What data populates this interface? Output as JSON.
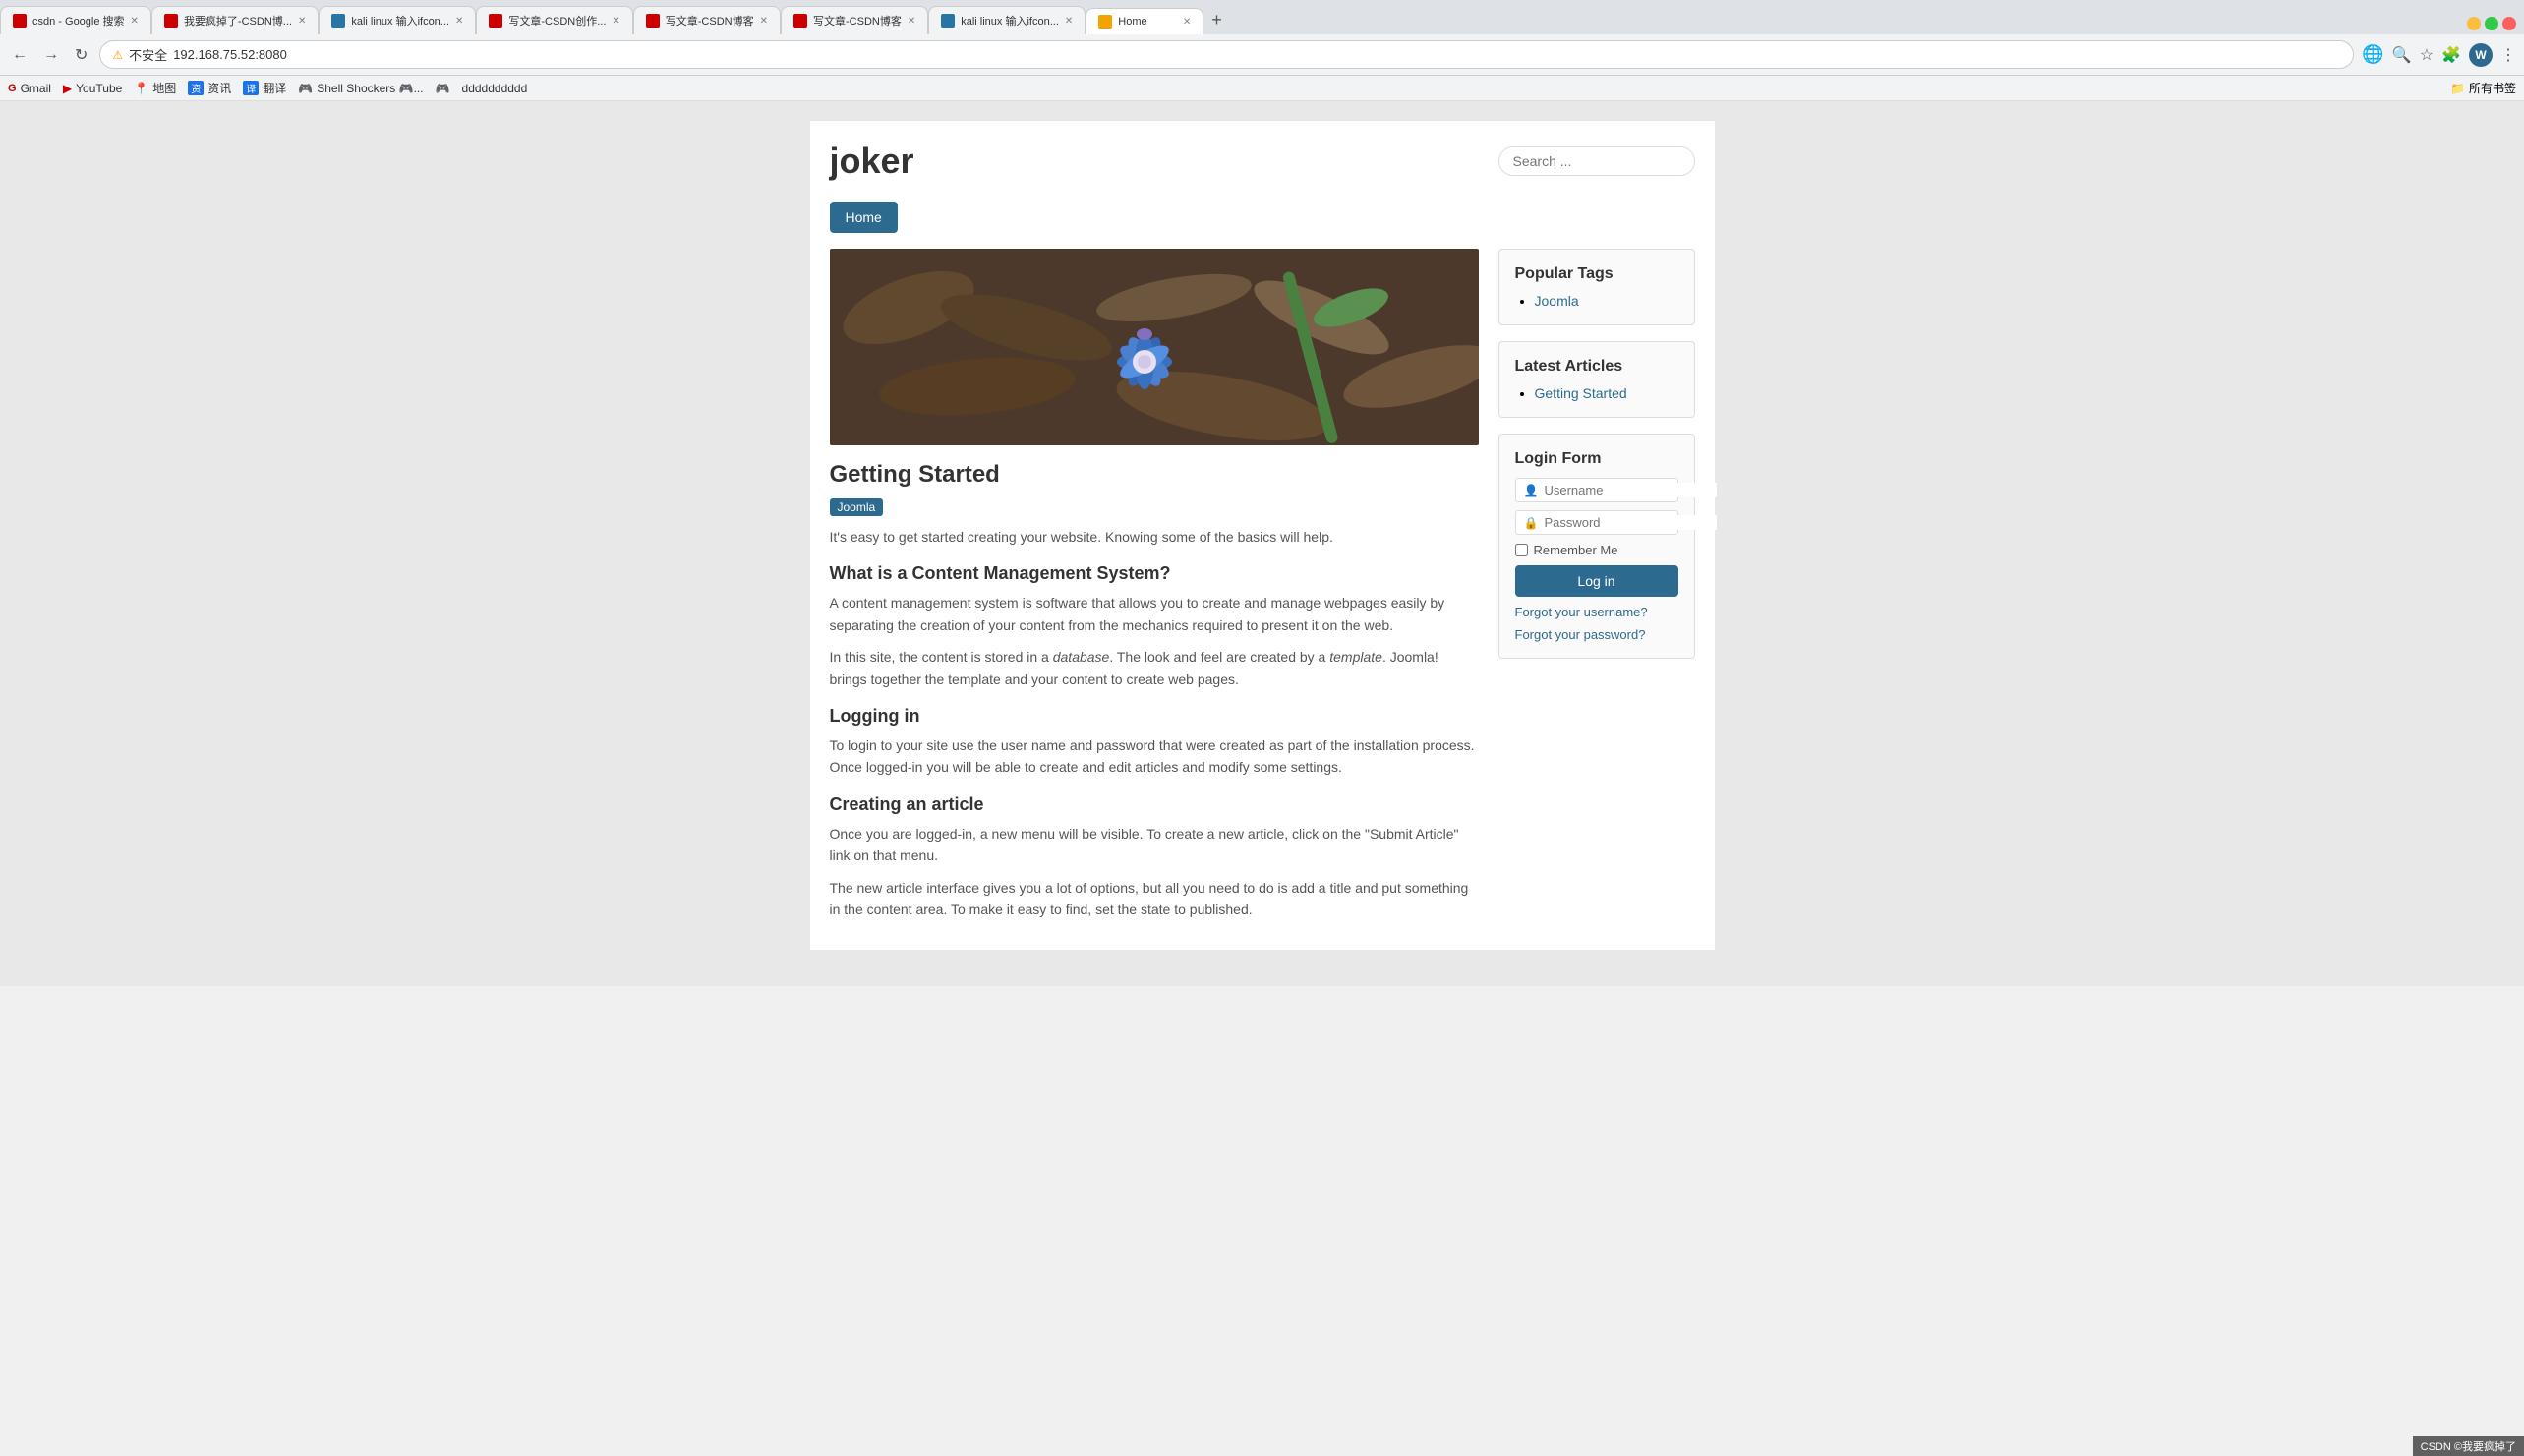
{
  "browser": {
    "tabs": [
      {
        "id": 1,
        "label": "csdn - Google 搜索",
        "favicon_color": "#c00",
        "active": false
      },
      {
        "id": 2,
        "label": "我要疯掉了-CSDN博客",
        "favicon_color": "#c00",
        "active": false
      },
      {
        "id": 3,
        "label": "kali linux 输入ifcon...",
        "favicon_color": "#2874a6",
        "active": false
      },
      {
        "id": 4,
        "label": "写文章-CSDN创作...",
        "favicon_color": "#c00",
        "active": false
      },
      {
        "id": 5,
        "label": "写文章-CSDN博客",
        "favicon_color": "#c00",
        "active": false
      },
      {
        "id": 6,
        "label": "写文章-CSDN博客",
        "favicon_color": "#c00",
        "active": false
      },
      {
        "id": 7,
        "label": "kali linux 输入ifcon...",
        "favicon_color": "#2874a6",
        "active": false
      },
      {
        "id": 8,
        "label": "Home",
        "favicon_color": "#f4a400",
        "active": true
      }
    ],
    "address": "192.168.75.52:8080",
    "security_label": "不安全",
    "bookmarks": [
      {
        "label": "Gmail",
        "favicon": "G"
      },
      {
        "label": "YouTube",
        "favicon": "▶"
      },
      {
        "label": "地图",
        "favicon": "📍"
      },
      {
        "label": "资讯",
        "favicon": "资"
      },
      {
        "label": "翻译",
        "favicon": "译"
      },
      {
        "label": "Shell Shockers 🎮..."
      },
      {
        "label": "🎮"
      },
      {
        "label": "dddddddddd"
      }
    ],
    "bookmarks_right_label": "所有书签"
  },
  "page": {
    "site_title": "joker",
    "search_placeholder": "Search ...",
    "nav": {
      "home_label": "Home"
    },
    "main": {
      "article_title": "Getting Started",
      "article_tag": "Joomla",
      "article_intro": "It's easy to get started creating your website. Knowing some of the basics will help.",
      "sections": [
        {
          "title": "What is a Content Management System?",
          "paragraphs": [
            "A content management system is software that allows you to create and manage webpages easily by separating the creation of your content from the mechanics required to present it on the web.",
            "In this site, the content is stored in a database. The look and feel are created by a template. Joomla! brings together the template and your content to create web pages."
          ]
        },
        {
          "title": "Logging in",
          "paragraphs": [
            "To login to your site use the user name and password that were created as part of the installation process. Once logged-in you will be able to create and edit articles and modify some settings."
          ]
        },
        {
          "title": "Creating an article",
          "paragraphs": [
            "Once you are logged-in, a new menu will be visible. To create a new article, click on the \"Submit Article\" link on that menu.",
            "The new article interface gives you a lot of options, but all you need to do is add a title and put something in the content area. To make it easy to find, set the state to published."
          ]
        }
      ]
    },
    "sidebar": {
      "popular_tags": {
        "title": "Popular Tags",
        "items": [
          "Joomla"
        ]
      },
      "latest_articles": {
        "title": "Latest Articles",
        "items": [
          "Getting Started"
        ]
      },
      "login_form": {
        "title": "Login Form",
        "username_placeholder": "Username",
        "password_placeholder": "Password",
        "remember_label": "Remember Me",
        "login_button": "Log in",
        "forgot_username": "Forgot your username?",
        "forgot_password": "Forgot your password?"
      }
    }
  },
  "status_bar": {
    "label": "CSDN ©我要疯掉了"
  }
}
